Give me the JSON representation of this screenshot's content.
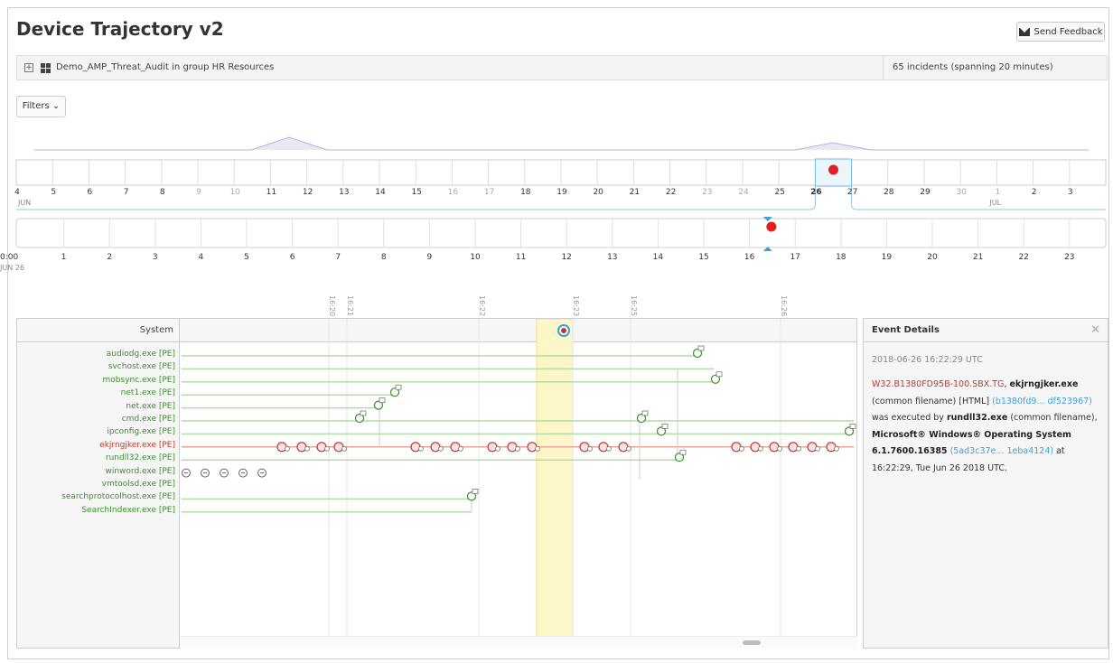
{
  "page": {
    "title": "Device Trajectory v2",
    "feedback_label": "Send Feedback"
  },
  "device": {
    "name": "Demo_AMP_Threat_Audit in group HR Resources",
    "incidents": "65 incidents (spanning 20 minutes)"
  },
  "filters_label": "Filters",
  "day_timeline": {
    "days": [
      "4",
      "5",
      "6",
      "7",
      "8",
      "9",
      "10",
      "11",
      "12",
      "13",
      "14",
      "15",
      "16",
      "17",
      "18",
      "19",
      "20",
      "21",
      "22",
      "23",
      "24",
      "25",
      "26",
      "27",
      "28",
      "29",
      "30",
      "1",
      "2",
      "3"
    ],
    "light_days": [
      "9",
      "10",
      "16",
      "17",
      "23",
      "24",
      "30",
      "1"
    ],
    "start_month": "JUN",
    "end_month": "JUL",
    "selected_day": "26"
  },
  "hour_timeline": {
    "hours": [
      "0:00",
      "1",
      "2",
      "3",
      "4",
      "5",
      "6",
      "7",
      "8",
      "9",
      "10",
      "11",
      "12",
      "13",
      "14",
      "15",
      "16",
      "17",
      "18",
      "19",
      "20",
      "21",
      "22",
      "23"
    ],
    "date_label": "JUN 26",
    "event_hour": 16.4
  },
  "time_ticks": [
    "16:20",
    "16:21",
    "16:22",
    "16:23",
    "16:25",
    "16:26"
  ],
  "system": {
    "header": "System",
    "processes": [
      {
        "name": "audiodg.exe [PE]",
        "status": "normal"
      },
      {
        "name": "svchost.exe [PE]",
        "status": "normal"
      },
      {
        "name": "mobsync.exe [PE]",
        "status": "normal"
      },
      {
        "name": "net1.exe [PE]",
        "status": "normal"
      },
      {
        "name": "net.exe [PE]",
        "status": "normal"
      },
      {
        "name": "cmd.exe [PE]",
        "status": "normal"
      },
      {
        "name": "ipconfig.exe [PE]",
        "status": "normal"
      },
      {
        "name": "ekjrngjker.exe [PE]",
        "status": "malicious"
      },
      {
        "name": "rundll32.exe [PE]",
        "status": "normal"
      },
      {
        "name": "winword.exe [PE]",
        "status": "normal"
      },
      {
        "name": "vmtoolsd.exe [PE]",
        "status": "normal"
      },
      {
        "name": "searchprotocolhost.exe [PE]",
        "status": "normal"
      },
      {
        "name": "SearchIndexer.exe [PE]",
        "status": "normal"
      }
    ]
  },
  "details": {
    "header": "Event Details",
    "timestamp": "2018-06-26 16:22:29 UTC",
    "threat": "W32.B1380FD95B-100.SBX.TG",
    "file": "ekjrngjker.exe",
    "t1": " (common filename) [HTML] ",
    "hash1": "(b1380fd9... df523967)",
    "t2": " was executed by ",
    "parent": "rundll32.exe",
    "t3": " (common filename), ",
    "os": "Microsoft® Windows® Operating System 6.1.7600.16385",
    "t4": " ",
    "hash2": "(5ad3c37e... 1eba4124)",
    "t5": " at 16:22:29, Tue Jun 26 2018 UTC."
  },
  "colors": {
    "malicious": "#c0392b",
    "clean": "#3a8f2a",
    "hash_link": "#3ca0d6",
    "selection": "#fdf6c9"
  }
}
